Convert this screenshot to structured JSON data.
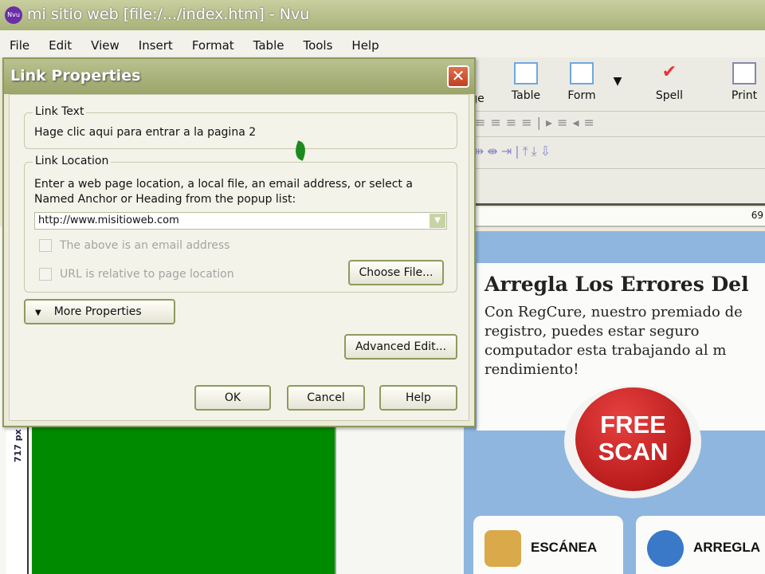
{
  "window": {
    "title": "mi sitio web [file:/.../index.htm] - Nvu",
    "app_icon": "Nvu"
  },
  "menu": [
    "File",
    "Edit",
    "View",
    "Insert",
    "Format",
    "Table",
    "Tools",
    "Help"
  ],
  "toolbar": {
    "items": [
      "Image",
      "Table",
      "Form",
      "Spell",
      "Print"
    ],
    "image_partial": "ge"
  },
  "ruler": {
    "value": "69"
  },
  "vruler": {
    "value": "717 px"
  },
  "dialog": {
    "title": "Link Properties",
    "link_text_group": "Link Text",
    "link_text": "Hage clic aqui para entrar a la pagina 2",
    "link_location_group": "Link Location",
    "instructions": "Enter a web page location, a local file, an email address, or select a Named Anchor or Heading from the popup list:",
    "url_value": "http://www.misitioweb.com",
    "email_checkbox": "The above is an email address",
    "relative_checkbox": "URL is relative to page location",
    "choose_file": "Choose File...",
    "more_properties": "More Properties",
    "advanced_edit": "Advanced Edit...",
    "ok": "OK",
    "cancel": "Cancel",
    "help": "Help"
  },
  "ad": {
    "title": "Arregla Los Errores Del",
    "body": "Con RegCure, nuestro premiado de registro, puedes estar seguro computador esta trabajando al m rendimiento!",
    "scan_line1": "FREE",
    "scan_line2": "SCAN",
    "card1": "ESCÁNEA",
    "card2": "ARREGLA"
  }
}
